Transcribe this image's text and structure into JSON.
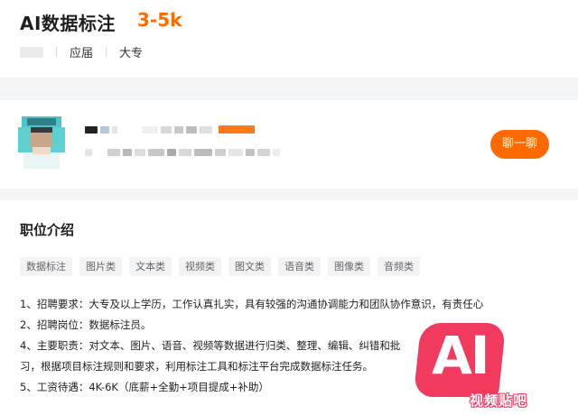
{
  "job": {
    "title": "AI数据标注",
    "salary": "3-5k",
    "experience": "应届",
    "education": "大专"
  },
  "recruiter": {
    "chat_label": "聊一聊",
    "accent_color": "#ff6a00"
  },
  "section": {
    "title": "职位介绍"
  },
  "tags": [
    "数据标注",
    "图片类",
    "文本类",
    "视频类",
    "图文类",
    "语音类",
    "图像类",
    "音频类"
  ],
  "description": [
    "1、招聘要求：大专及以上学历，工作认真扎实，具有较强的沟通协调能力和团队协作意识，有责任心",
    "2、招聘岗位：数据标注员。",
    "4、主要职责：对文本、图片、语音、视频等数据进行归类、整理、编辑、纠错和批",
    "习，根据项目标注规则和要求，利用标注工具和标注平台完成数据标注任务。",
    "5、工资待遇：4K-6K（底薪+全勤+项目提成+补助）"
  ],
  "watermark": {
    "logo": "AI",
    "text": "视频贴吧",
    "color": "#f23a5e"
  }
}
